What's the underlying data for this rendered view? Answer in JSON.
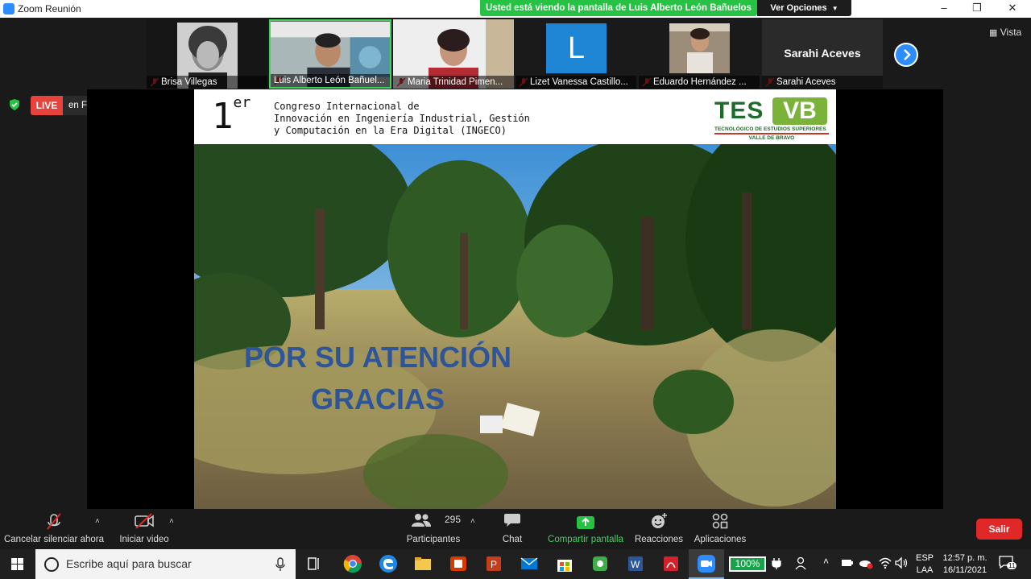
{
  "window": {
    "title": "Zoom Reunión",
    "share_banner": "Usted está viendo la pantalla de Luis Alberto León Bañuelos",
    "view_options": "Ver Opciones",
    "minimize": "–",
    "maximize": "❐",
    "close": "✕"
  },
  "gallery": {
    "view_label": "Vista",
    "participants": [
      {
        "name": "Brisa Villegas"
      },
      {
        "name": "Luis Alberto León Bañuel..."
      },
      {
        "name": "Maria Trinidad Pimen..."
      },
      {
        "name": "Lizet Vanessa Castillo...",
        "initial": "L"
      },
      {
        "name": "Eduardo Hernández ..."
      },
      {
        "name": "Sarahi Aceves",
        "display": "Sarahi Aceves"
      }
    ]
  },
  "live": {
    "badge": "LIVE",
    "platform": "en Facebook"
  },
  "slide": {
    "number": "1",
    "ordinal": "er",
    "conference_lines": [
      "Congreso Internacional de",
      "Innovación en Ingeniería Industrial, Gestión",
      "y Computación en la Era Digital (INGECO)"
    ],
    "logo_text_a": "TES",
    "logo_text_b": "VB",
    "logo_sub1": "TECNOLÓGICO DE ESTUDIOS SUPERIORES",
    "logo_sub2": "VALLE DE BRAVO",
    "thanks_line1": "POR SU ATENCIÓN",
    "thanks_line2": "GRACIAS"
  },
  "toolbar": {
    "mute": "Cancelar silenciar ahora",
    "video": "Iniciar video",
    "participants": "Participantes",
    "participant_count": "295",
    "chat": "Chat",
    "share": "Compartir pantalla",
    "reactions": "Reacciones",
    "apps": "Aplicaciones",
    "exit": "Salir"
  },
  "taskbar": {
    "search_placeholder": "Escribe aquí para buscar",
    "battery": "100%",
    "lang1": "ESP",
    "lang2": "LAA",
    "time": "12:57 p. m.",
    "date": "16/11/2021",
    "notifications": "11"
  },
  "colors": {
    "zoom_blue": "#2d8cff",
    "share_green": "#27c244",
    "live_red": "#e8423d",
    "exit_red": "#e02828",
    "thanks_blue": "#2e5597"
  }
}
